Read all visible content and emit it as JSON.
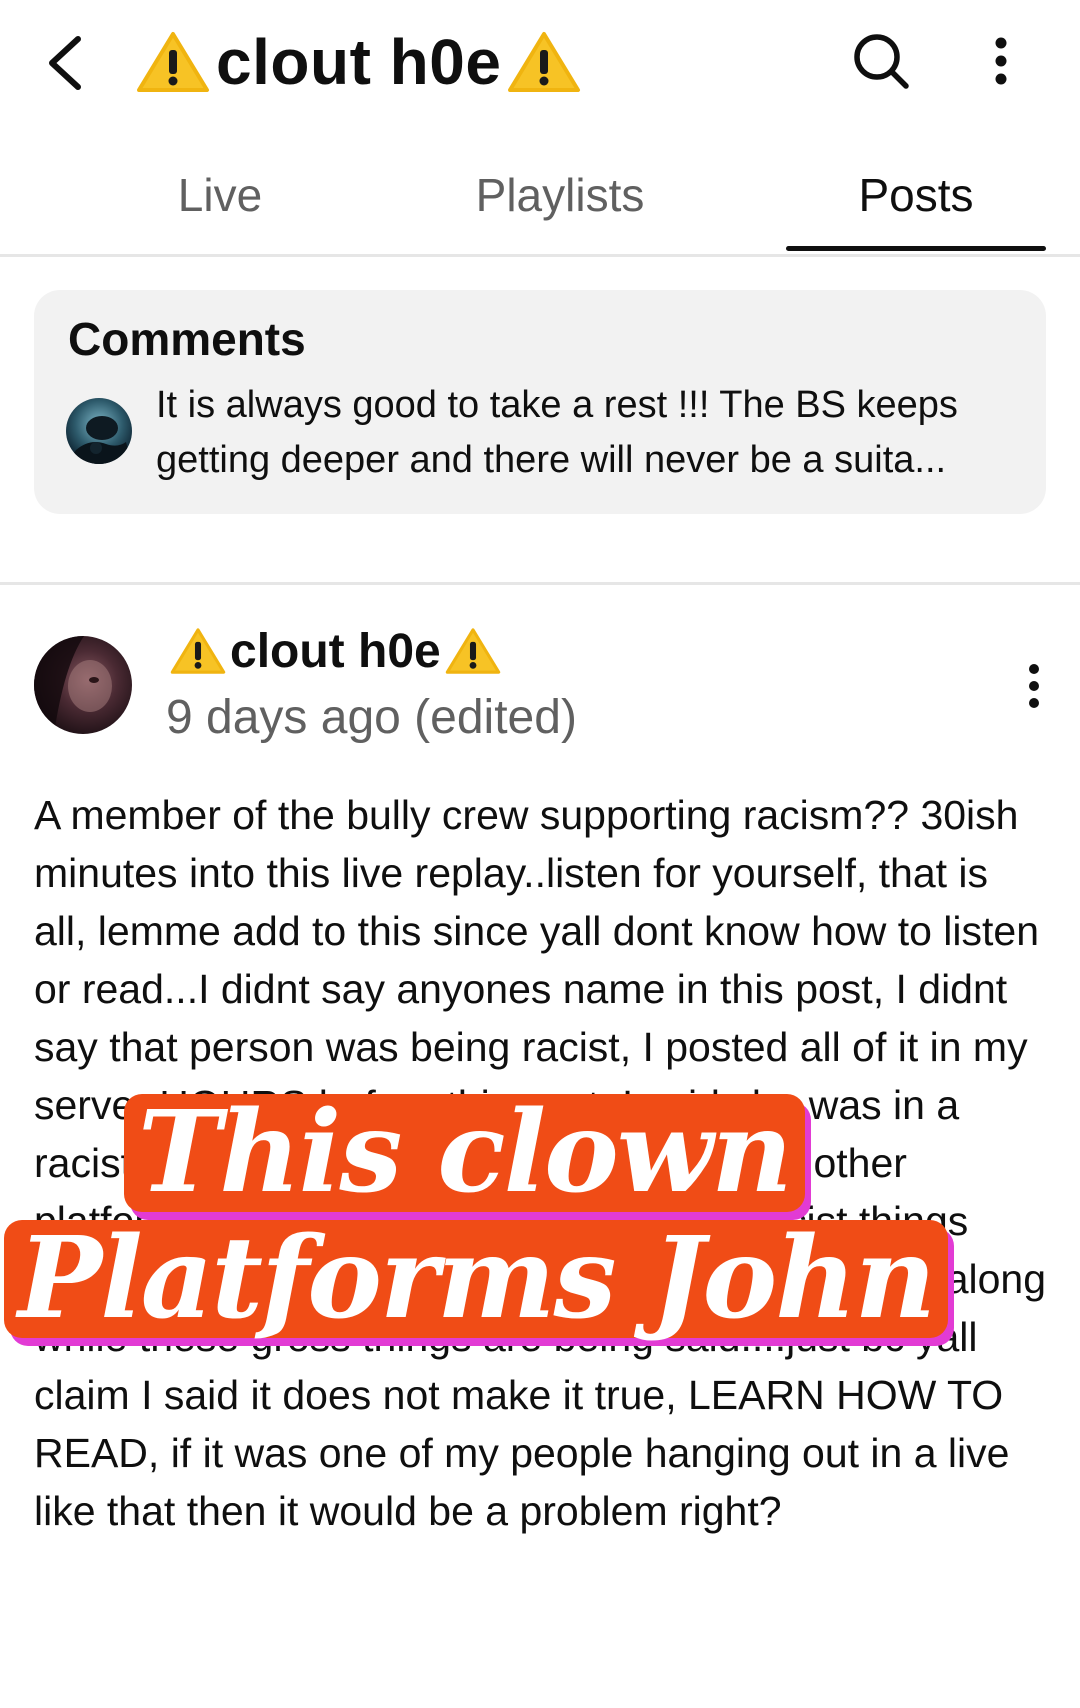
{
  "header": {
    "title": "clout h0e",
    "back_icon": "back-arrow-icon",
    "search_icon": "search-icon",
    "menu_icon": "more-vertical-icon"
  },
  "tabs": [
    {
      "label": "Live",
      "active": false
    },
    {
      "label": "Playlists",
      "active": false
    },
    {
      "label": "Posts",
      "active": true
    }
  ],
  "comments": {
    "title": "Comments",
    "preview_text": "It is always good to take a rest !!! The BS keeps getting deeper and there will never be a suita..."
  },
  "post": {
    "author": "clout h0e",
    "timestamp": "9 days ago (edited)",
    "body": "A member of the bully crew supporting racism?? 30ish minutes into this live replay..listen for yourself, that is all, lemme add to this since yall dont know how to listen or read...I didnt say anyones name in this post, I didnt say that person was being racist, I posted all of it in my server HOURS before this post. I  said she was in a racist live and it was being called out on another platform by a black creator, where very racist things were being said, her voice is even heard laughing along while these gross things are being said....just bc yall claim I said it does not make it true, LEARN HOW TO READ, if it was one of my people hanging out in a live like that then it would be a problem right?"
  },
  "overlay_caption": {
    "line1": "This clown",
    "line2": "Platforms John"
  },
  "colors": {
    "warning_yellow": "#f7c325",
    "caption_orange": "#f04c16",
    "caption_shadow": "#e23bd4",
    "text_secondary": "#606060"
  }
}
